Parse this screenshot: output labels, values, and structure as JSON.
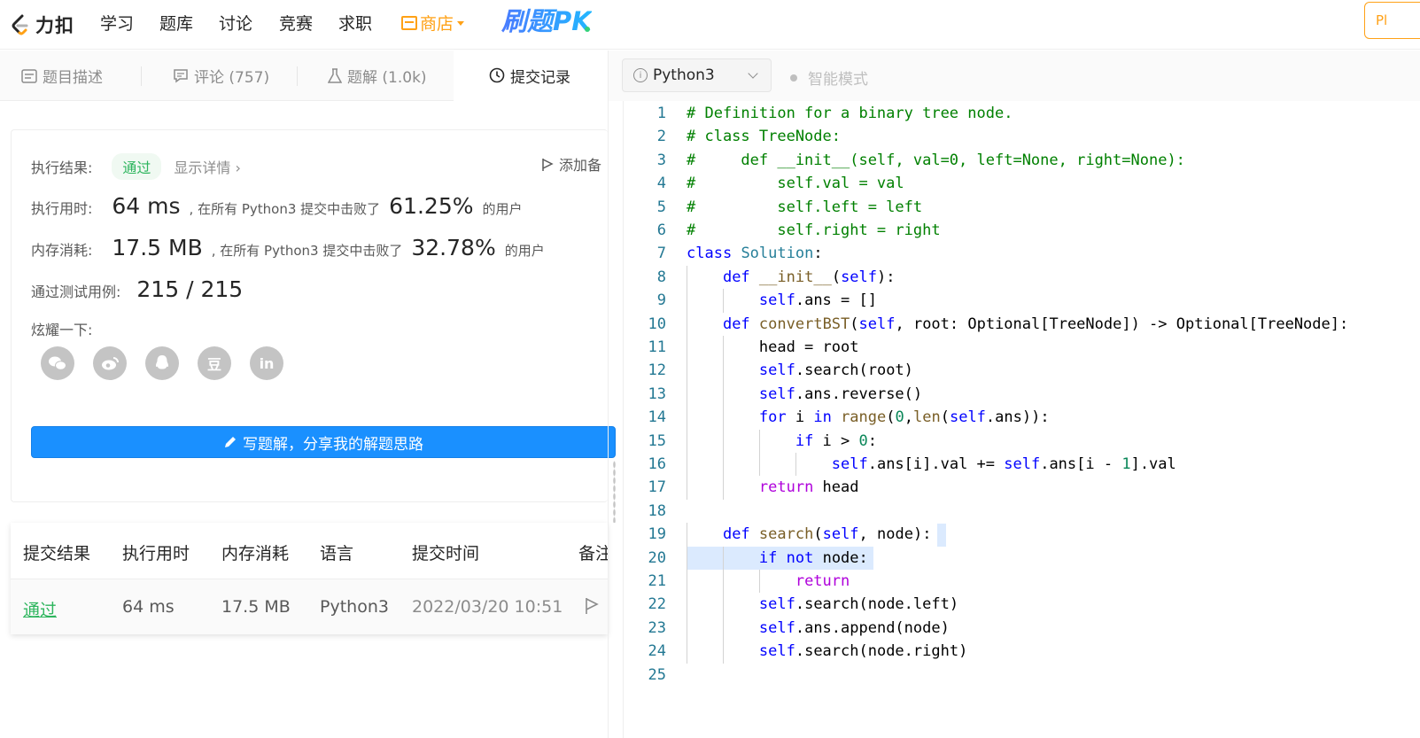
{
  "nav": {
    "logo_text": "力扣",
    "links": [
      "学习",
      "题库",
      "讨论",
      "竞赛",
      "求职"
    ],
    "shop_label": "商店",
    "pk_label": "刷题PK",
    "corner_label": "Pl"
  },
  "tabs": [
    {
      "label": "题目描述",
      "icon": "doc-icon"
    },
    {
      "label": "评论 (757)",
      "icon": "comment-icon"
    },
    {
      "label": "题解 (1.0k)",
      "icon": "flask-icon"
    },
    {
      "label": "提交记录",
      "icon": "clock-icon"
    }
  ],
  "result": {
    "status_label": "执行结果:",
    "status_value": "通过",
    "detail_link": "显示详情 ›",
    "add_note": "添加备",
    "runtime_label": "执行用时:",
    "runtime_value": "64 ms",
    "runtime_text": ", 在所有 Python3 提交中击败了",
    "runtime_pct": "61.25%",
    "runtime_suffix": "的用户",
    "memory_label": "内存消耗:",
    "memory_value": "17.5 MB",
    "memory_text": ", 在所有 Python3 提交中击败了",
    "memory_pct": "32.78%",
    "memory_suffix": "的用户",
    "tests_label": "通过测试用例:",
    "tests_value": "215 / 215",
    "share_label": "炫耀一下:",
    "share_icons": [
      "wechat-icon",
      "weibo-icon",
      "qq-icon",
      "douban-icon",
      "linkedin-icon"
    ],
    "write_button": "写题解，分享我的解题思路"
  },
  "submissions": {
    "headers": [
      "提交结果",
      "执行用时",
      "内存消耗",
      "语言",
      "提交时间",
      "备注"
    ],
    "rows": [
      {
        "result": "通过",
        "runtime": "64 ms",
        "memory": "17.5 MB",
        "language": "Python3",
        "time": "2022/03/20 10:51"
      }
    ]
  },
  "editor": {
    "language": "Python3",
    "smart_mode": "智能模式",
    "lines": [
      "# Definition for a binary tree node.",
      "# class TreeNode:",
      "#     def __init__(self, val=0, left=None, right=None):",
      "#         self.val = val",
      "#         self.left = left",
      "#         self.right = right",
      "class Solution:",
      "    def __init__(self):",
      "        self.ans = []",
      "    def convertBST(self, root: Optional[TreeNode]) -> Optional[TreeNode]:",
      "        head = root",
      "        self.search(root)",
      "        self.ans.reverse()",
      "        for i in range(0,len(self.ans)):",
      "            if i > 0:",
      "                self.ans[i].val += self.ans[i - 1].val",
      "        return head",
      "",
      "    def search(self, node):",
      "        if not node:",
      "            return",
      "        self.search(node.left)",
      "        self.ans.append(node)",
      "        self.search(node.right)",
      ""
    ]
  }
}
